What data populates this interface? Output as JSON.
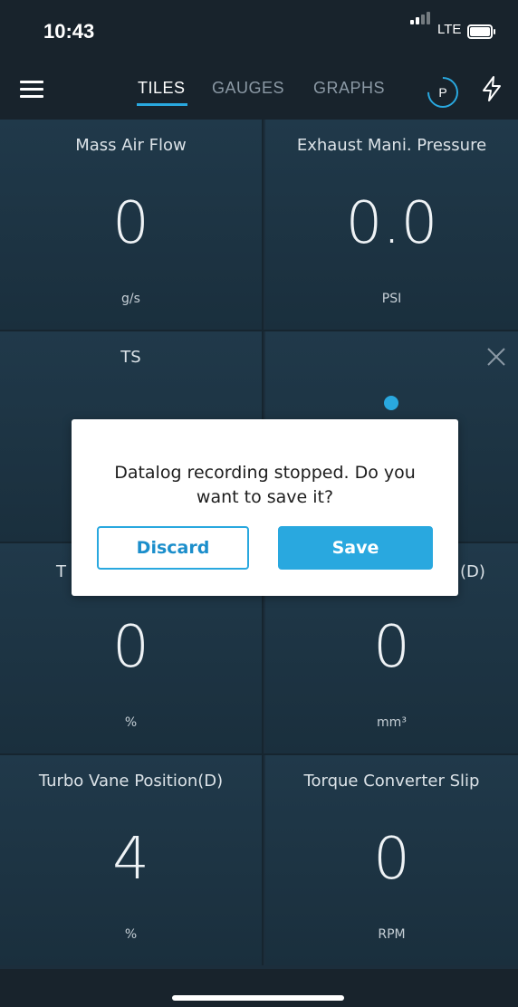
{
  "status_bar": {
    "time": "10:43",
    "network": "LTE"
  },
  "nav": {
    "tabs": [
      {
        "label": "TILES",
        "active": true
      },
      {
        "label": "GAUGES",
        "active": false
      },
      {
        "label": "GRAPHS",
        "active": false
      }
    ],
    "profile_letter": "P"
  },
  "tiles": [
    {
      "label": "Mass Air Flow",
      "value": "0",
      "unit": "g/s"
    },
    {
      "label": "Exhaust Mani. Pressure",
      "value": "0.0",
      "unit": "PSI"
    },
    {
      "label": "TS",
      "value": "",
      "unit": ""
    },
    {
      "label": "",
      "value": "",
      "unit": ""
    },
    {
      "label": "T",
      "value": "0",
      "unit": "%"
    },
    {
      "label": "(D)",
      "value": "0",
      "unit": "mm³"
    },
    {
      "label": "Turbo Vane Position(D)",
      "value": "4",
      "unit": "%"
    },
    {
      "label": "Torque Converter Slip",
      "value": "0",
      "unit": "RPM"
    }
  ],
  "dialog": {
    "message": "Datalog recording stopped. Do you want to save it?",
    "discard_label": "Discard",
    "save_label": "Save"
  },
  "colors": {
    "accent": "#29a8df",
    "background": "#1c2e3c"
  }
}
